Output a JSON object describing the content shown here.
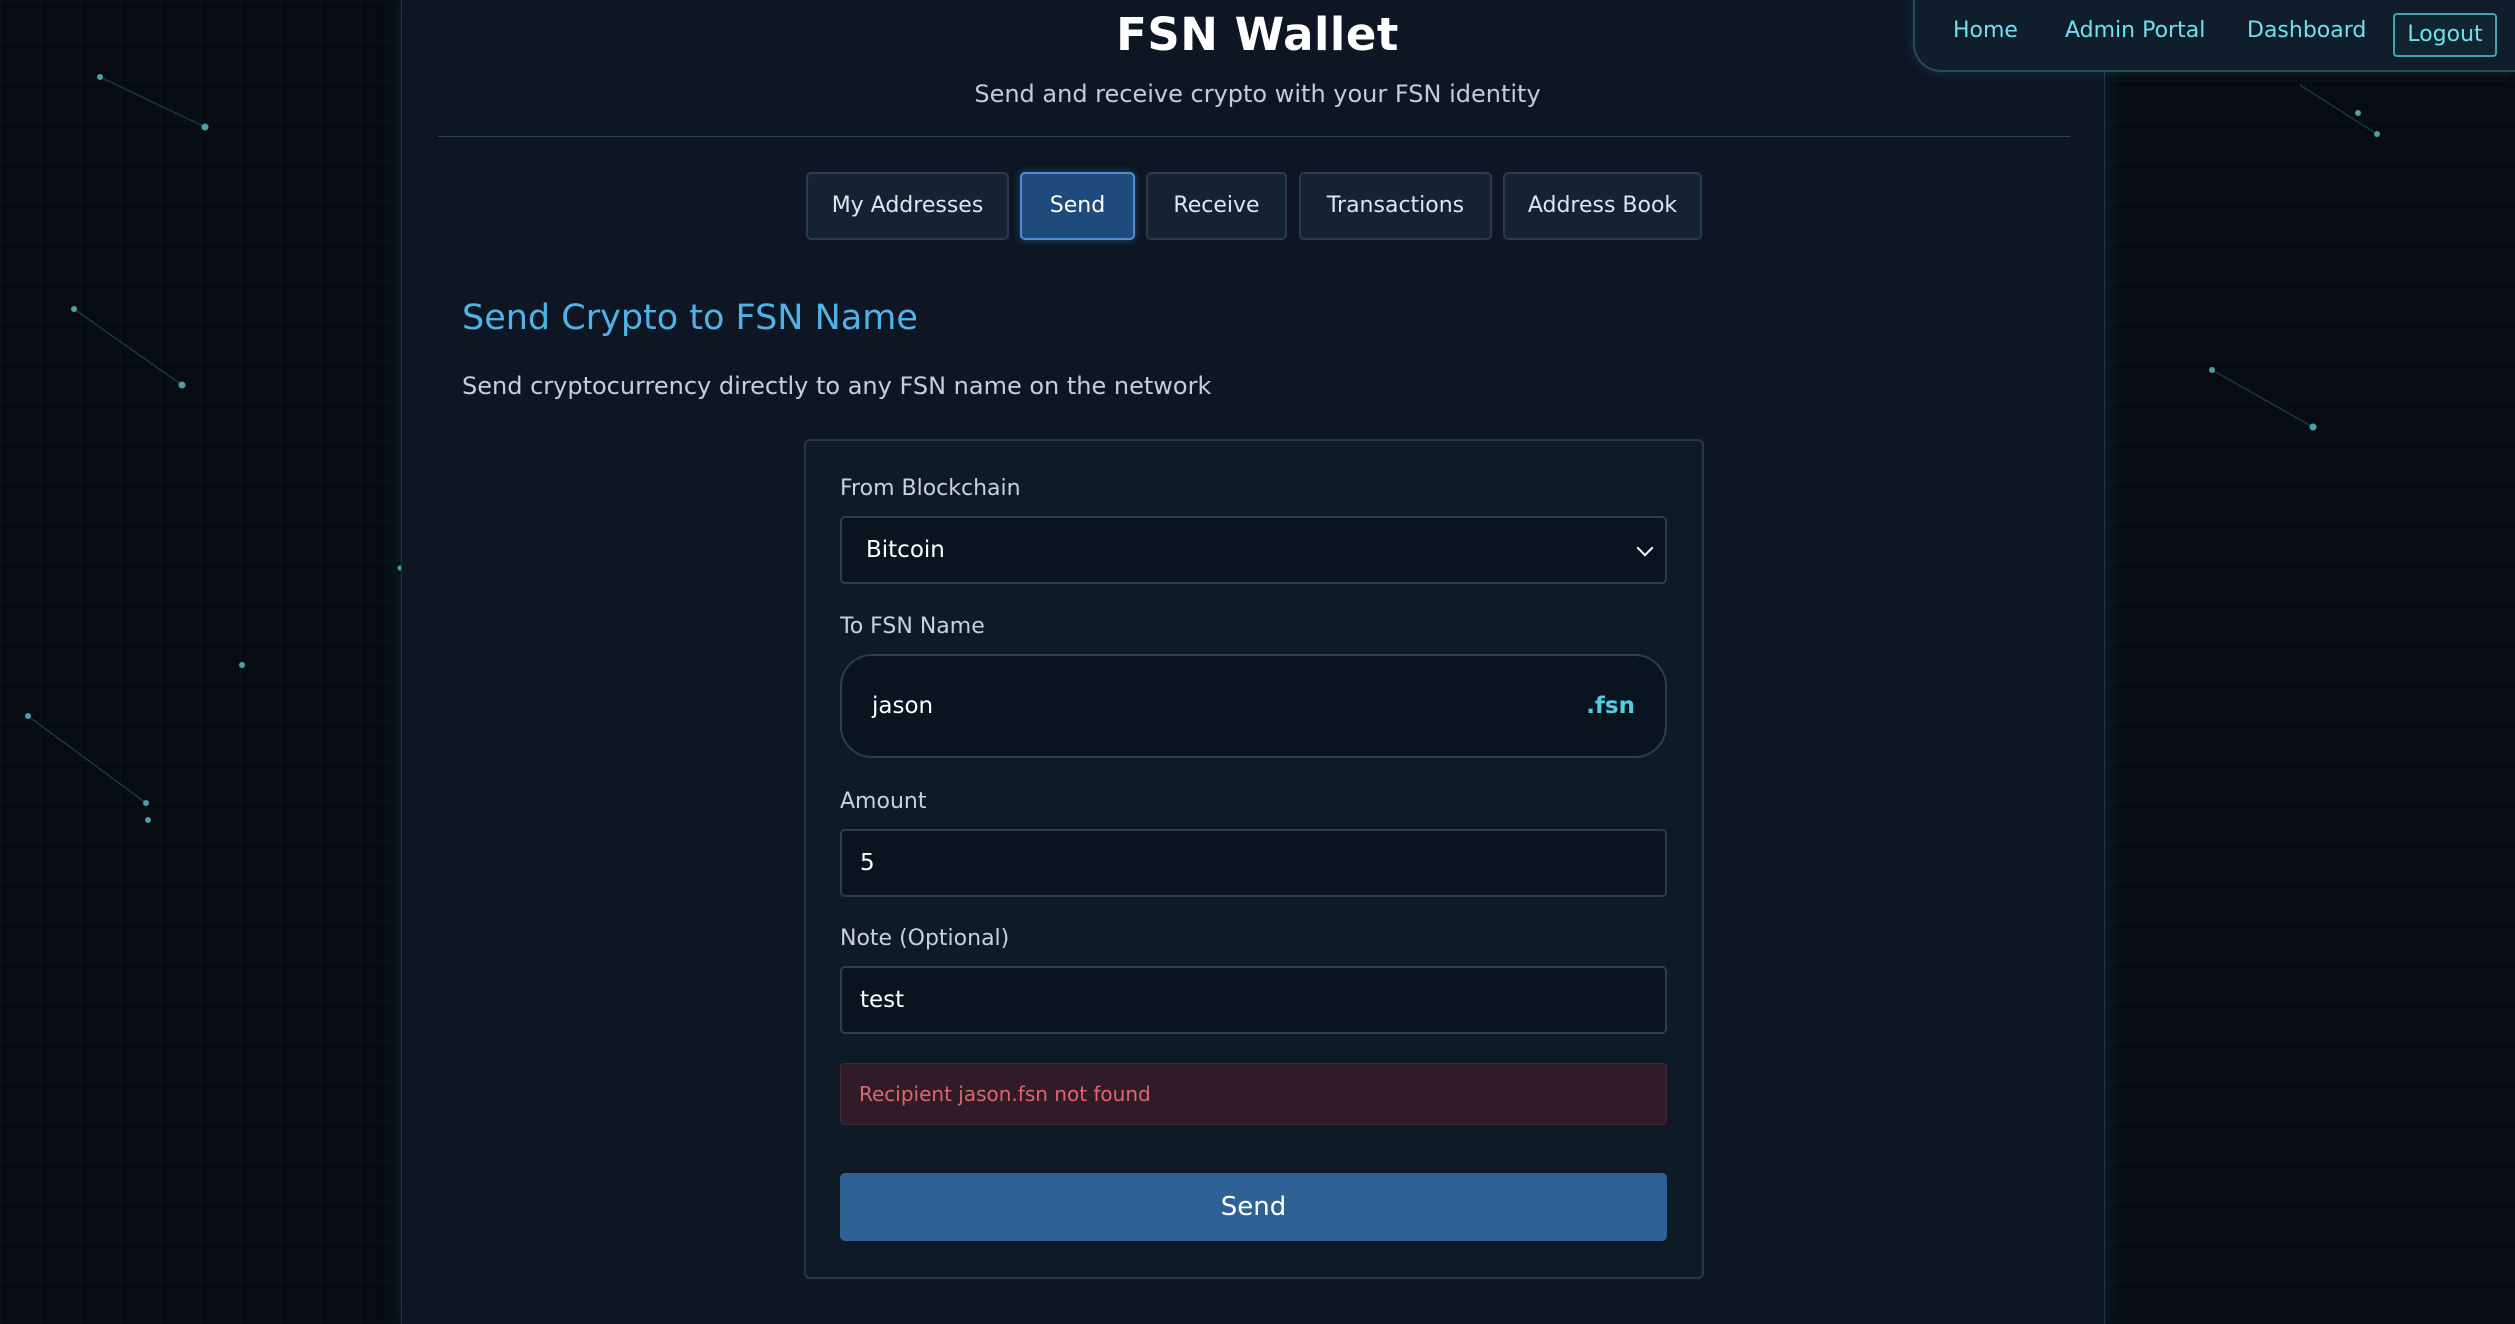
{
  "app": {
    "title": "FSN Wallet",
    "subtitle": "Send and receive crypto with your FSN identity"
  },
  "nav": {
    "home": "Home",
    "admin_portal": "Admin Portal",
    "dashboard": "Dashboard",
    "logout": "Logout"
  },
  "tabs": [
    {
      "label": "My Addresses",
      "active": false
    },
    {
      "label": "Send",
      "active": true
    },
    {
      "label": "Receive",
      "active": false
    },
    {
      "label": "Transactions",
      "active": false
    },
    {
      "label": "Address Book",
      "active": false
    }
  ],
  "send_form": {
    "title": "Send Crypto to FSN Name",
    "description": "Send cryptocurrency directly to any FSN name on the network",
    "from_label": "From Blockchain",
    "from_value": "Bitcoin",
    "to_label": "To FSN Name",
    "to_value": "jason",
    "to_suffix": ".fsn",
    "amount_label": "Amount",
    "amount_value": "5",
    "note_label": "Note (Optional)",
    "note_value": "test",
    "error_message": "Recipient jason.fsn not found",
    "send_label": "Send"
  },
  "colors": {
    "accent": "#4fb3e8",
    "nav_link": "#6fe0ee",
    "active_tab": "#1e4a7c",
    "send_button": "#2f6194",
    "error_text": "#e0666e",
    "error_bg": "#2f1c26"
  }
}
